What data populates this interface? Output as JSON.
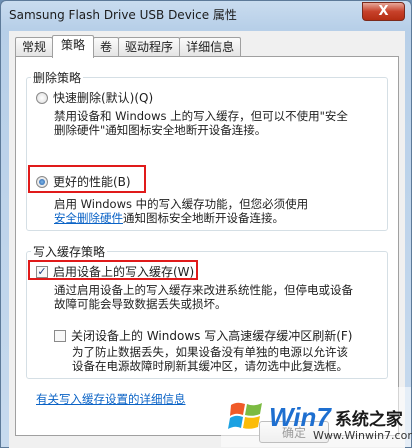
{
  "window": {
    "title": "Samsung Flash Drive USB Device 属性",
    "close_label": "X"
  },
  "tabs": [
    {
      "label": "常规"
    },
    {
      "label": "策略"
    },
    {
      "label": "卷"
    },
    {
      "label": "驱动程序"
    },
    {
      "label": "详细信息"
    }
  ],
  "removal_policy": {
    "legend": "删除策略",
    "quick_label": "快速删除(默认)(Q)",
    "quick_desc_1": "禁用设备和 Windows 上的写入缓存，但可以不使用\"安全",
    "quick_desc_2": "删除硬件\"通知图标安全地断开设备连接。",
    "better_label": "更好的性能(B)",
    "better_desc_1": "启用 Windows 中的写入缓存功能，但您必须使用",
    "better_desc_link": "安全删除硬件",
    "better_desc_2": "通知图标安全地断开设备连接。",
    "selected": "better"
  },
  "write_cache_policy": {
    "legend": "写入缓存策略",
    "enable_label": "启用设备上的写入缓存(W)",
    "enable_checked": true,
    "enable_desc_1": "通过启用设备上的写入缓存来改进系统性能，但停电或设备",
    "enable_desc_2": "故障可能会导致数据丢失或损坏。",
    "flush_label": "关闭设备上的 Windows 写入高速缓存缓冲区刷新(F)",
    "flush_checked": false,
    "flush_desc_1": "为了防止数据丢失，如果设备没有单独的电源以允许该",
    "flush_desc_2": "设备在电源故障时刷新其缓冲区，请勿选中此复选框。"
  },
  "help_link": "有关写入缓存设置的详细信息",
  "buttons": {
    "ok": "确定"
  },
  "watermark": {
    "brand": "Win7",
    "site": "系统之家",
    "url": "Www.Winwin7.com"
  },
  "colors": {
    "highlight_box": "#e01a1a",
    "link": "#0b63c6"
  }
}
